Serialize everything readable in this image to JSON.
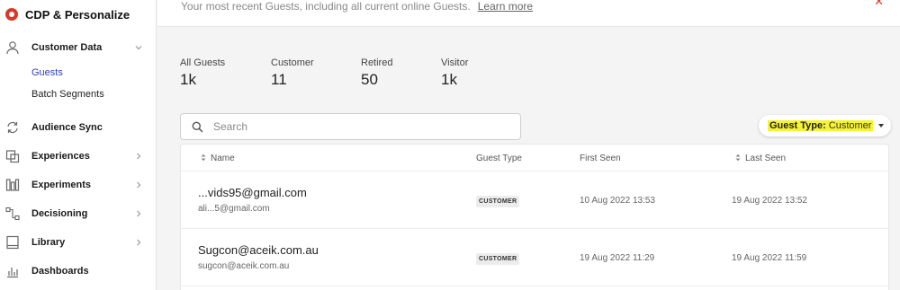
{
  "app": {
    "title": "CDP & Personalize"
  },
  "sidebar": {
    "items": [
      {
        "label": "Customer Data",
        "icon": "person-icon",
        "expanded": true,
        "children": [
          {
            "label": "Guests",
            "active": true
          },
          {
            "label": "Batch Segments",
            "active": false
          }
        ]
      },
      {
        "label": "Audience Sync",
        "icon": "sync-icon"
      },
      {
        "label": "Experiences",
        "icon": "experiences-icon"
      },
      {
        "label": "Experiments",
        "icon": "experiments-icon"
      },
      {
        "label": "Decisioning",
        "icon": "decisioning-icon"
      },
      {
        "label": "Library",
        "icon": "library-icon"
      },
      {
        "label": "Dashboards",
        "icon": "dashboards-icon"
      }
    ]
  },
  "banner": {
    "text": "Your most recent Guests, including all current online Guests.",
    "link": "Learn more"
  },
  "stats": [
    {
      "label": "All Guests",
      "value": "1k"
    },
    {
      "label": "Customer",
      "value": "11"
    },
    {
      "label": "Retired",
      "value": "50"
    },
    {
      "label": "Visitor",
      "value": "1k"
    }
  ],
  "search": {
    "placeholder": "Search",
    "value": ""
  },
  "filter": {
    "label": "Guest Type:",
    "value": "Customer",
    "highlight_color": "#f6f234"
  },
  "table": {
    "columns": {
      "name": "Name",
      "guest_type": "Guest Type",
      "first_seen": "First Seen",
      "last_seen": "Last Seen"
    },
    "rows": [
      {
        "name": "...vids95@gmail.com",
        "email": "ali...5@gmail.com",
        "guest_type": "CUSTOMER",
        "first_seen": "10 Aug 2022 13:53",
        "last_seen": "19 Aug 2022 13:52"
      },
      {
        "name": "Sugcon@aceik.com.au",
        "email": "sugcon@aceik.com.au",
        "guest_type": "CUSTOMER",
        "first_seen": "19 Aug 2022 11:29",
        "last_seen": "19 Aug 2022 11:59"
      }
    ]
  },
  "colors": {
    "accent": "#2b3fb7",
    "brand": "#d83a2a"
  }
}
